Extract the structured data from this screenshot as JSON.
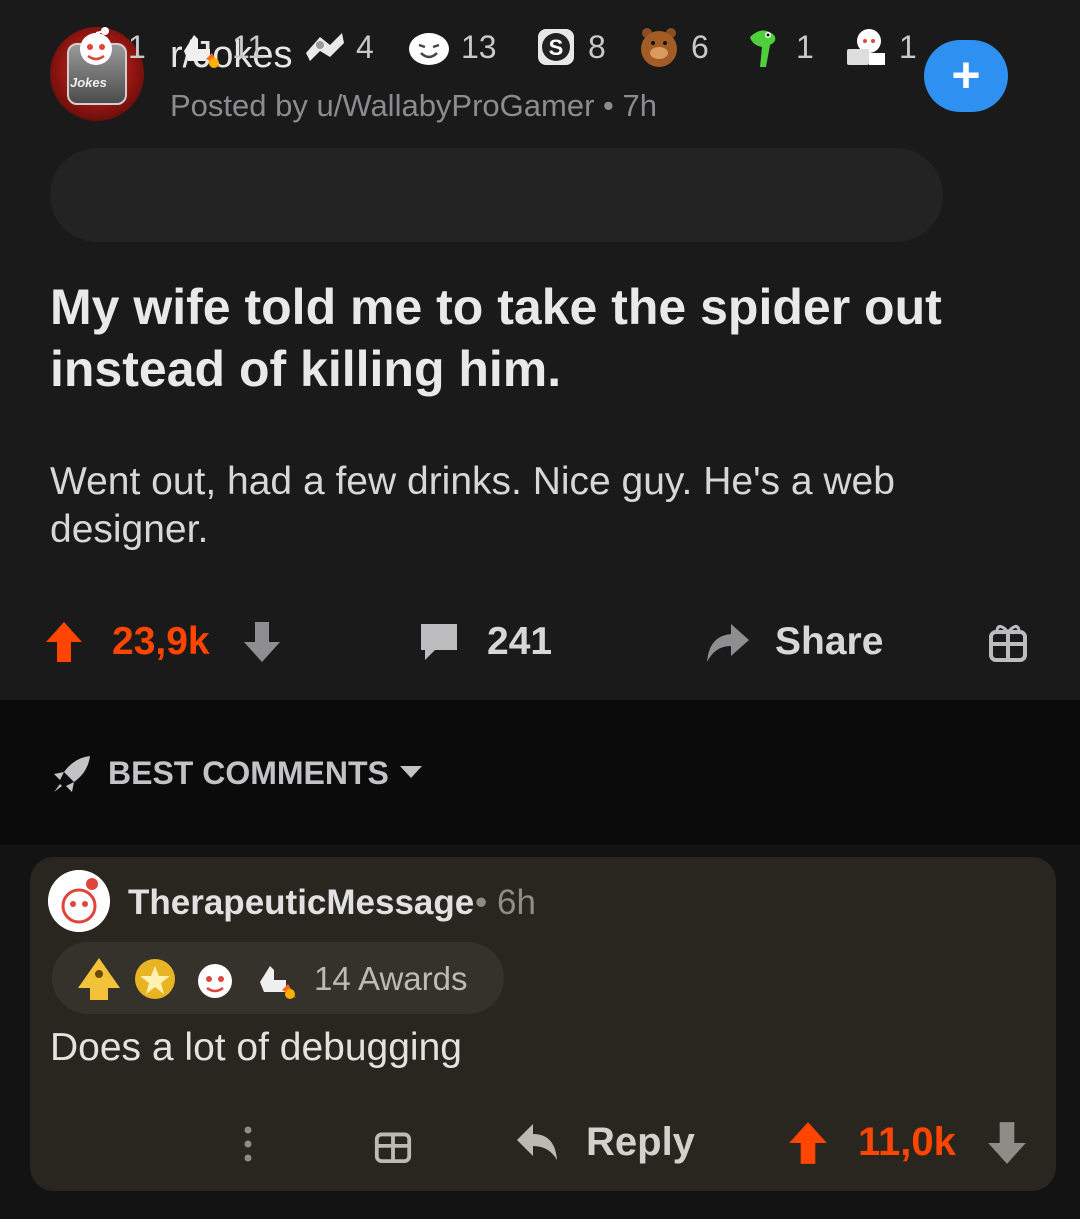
{
  "post": {
    "subreddit": "r/Jokes",
    "avatar_label": "Jokes",
    "posted_by": "Posted by u/WallabyProGamer • 7h",
    "join_label": "+",
    "awards": [
      {
        "icon": "wholesome-award-icon",
        "count": "1"
      },
      {
        "icon": "rocket-like-award-icon",
        "count": "11"
      },
      {
        "icon": "take-my-power-award-icon",
        "count": "4"
      },
      {
        "icon": "laughing-face-award-icon",
        "count": "13"
      },
      {
        "icon": "s-coin-award-icon",
        "count": "8"
      },
      {
        "icon": "bear-award-icon",
        "count": "6"
      },
      {
        "icon": "snake-award-icon",
        "count": "1"
      },
      {
        "icon": "snoo-reading-award-icon",
        "count": "1"
      }
    ],
    "title": "My wife told me to take the spider out instead of killing him.",
    "body": "Went out, had a few drinks. Nice guy. He's a web designer.",
    "score": "23,9k",
    "comments": "241",
    "share_label": "Share"
  },
  "sort": {
    "label": "BEST COMMENTS"
  },
  "comment": {
    "username": "TherapeuticMessage",
    "time": "• 6h",
    "awards_label": "14 Awards",
    "body": "Does a lot of debugging",
    "reply_label": "Reply",
    "score": "11,0k"
  },
  "colors": {
    "accent_upvote": "#ff4500",
    "join_button": "#2e90f1",
    "background": "#1a1a1b",
    "comment_card": "#292620"
  }
}
